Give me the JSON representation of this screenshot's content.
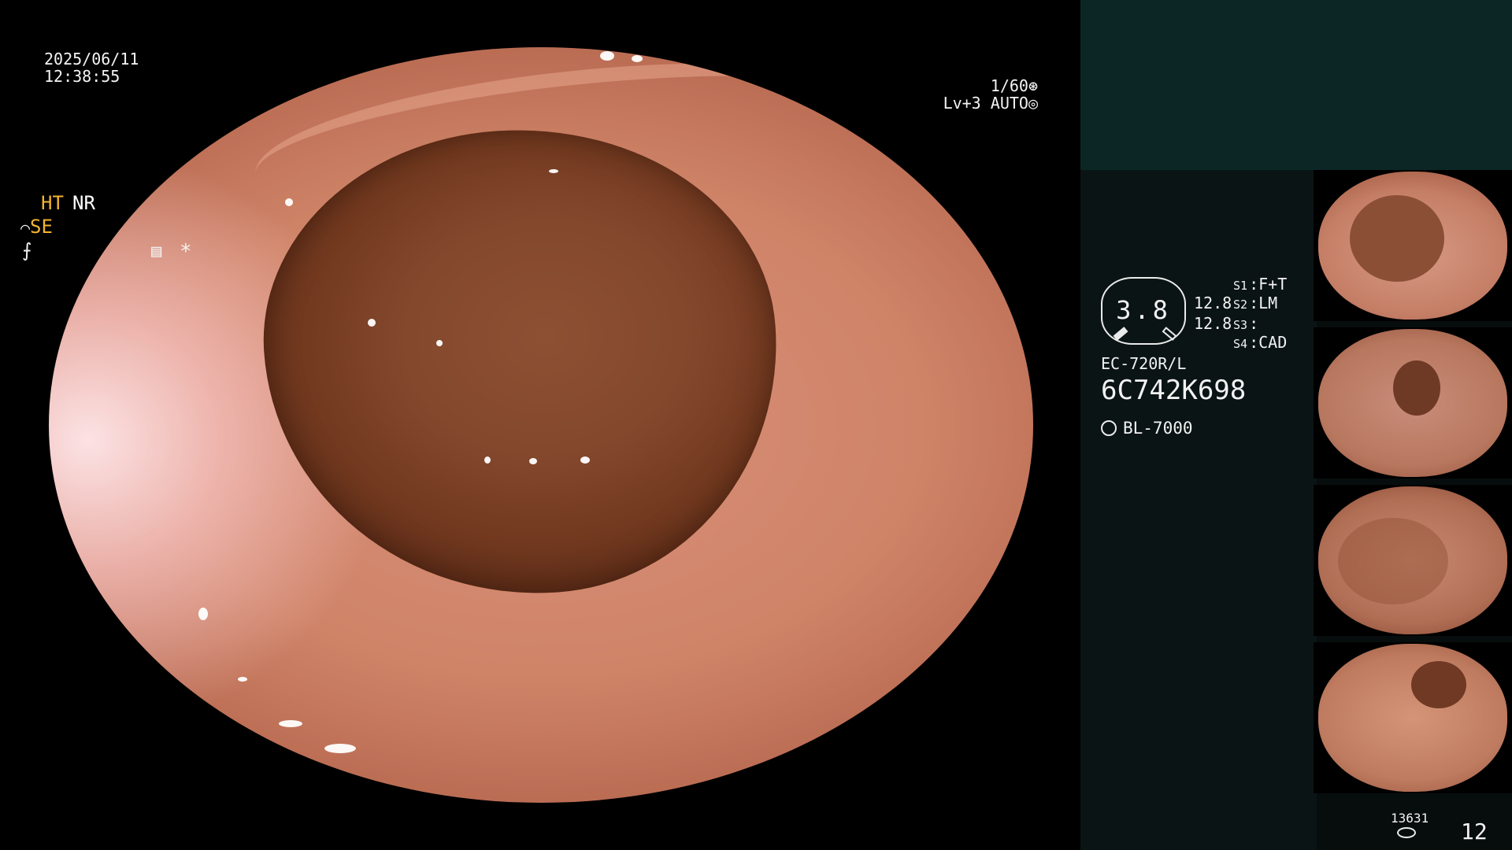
{
  "view": {
    "date": "2025/06/11",
    "time": "12:38:55",
    "shutter": "1/60",
    "level": "Lv+3",
    "iris_mode": "AUTO"
  },
  "panel": {
    "modes": {
      "ht": "HT",
      "nr": "NR",
      "se": "SE",
      "f_symbol": "⨍"
    },
    "gauge": {
      "value": "3.8",
      "num1": "12.8",
      "num2": "12.8"
    },
    "switches": {
      "s1_label": "S1",
      "s1_value": "F+T",
      "s2_label": "S2",
      "s2_value": "LM",
      "s3_label": "S3",
      "s3_value": "",
      "s4_label": "S4",
      "s4_value": "CAD"
    },
    "scope_model": "EC-720R/L",
    "scope_serial": "6C742K698",
    "light_source": "BL-7000"
  },
  "counters": {
    "small": "13631",
    "large": "12"
  },
  "colors": {
    "mode_accent": "#f2b431",
    "panel_top": "#0c2626",
    "panel_bg": "#070d0d"
  }
}
